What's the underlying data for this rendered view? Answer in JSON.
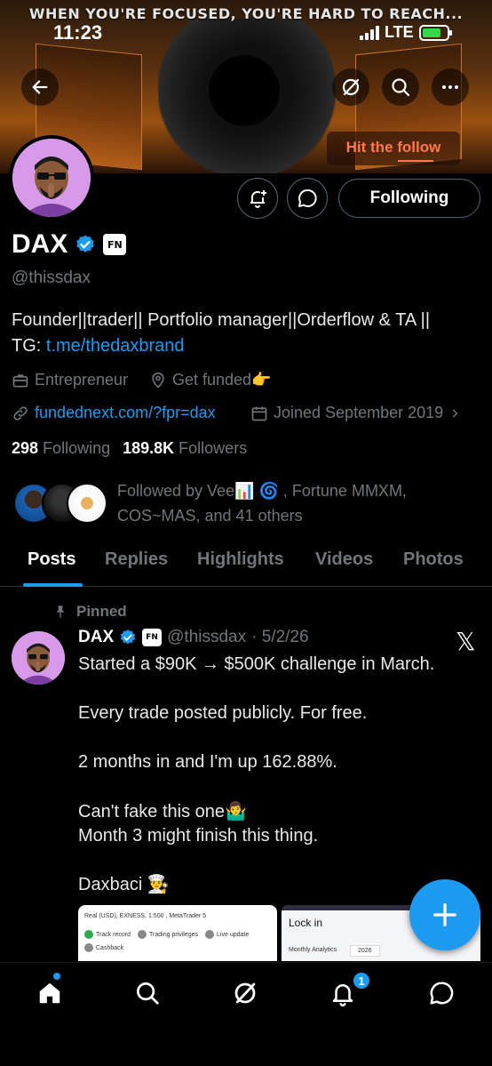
{
  "status_bar": {
    "time": "11:23",
    "network": "LTE"
  },
  "banner": {
    "headline": "WHEN YOU'RE FOCUSED, YOU'RE HARD TO REACH...",
    "cta": "Hit the follow"
  },
  "header_icons": [
    "back-arrow-icon",
    "grok-icon",
    "search-icon",
    "more-icon"
  ],
  "profile": {
    "name": "DAX",
    "handle": "@thissdax",
    "badge": "FN",
    "bio_text": "Founder||trader|| Portfolio manager||Orderflow & TA ||",
    "bio_tg_label": "TG: ",
    "bio_tg_link": "t.me/thedaxbrand",
    "category": "Entrepreneur",
    "location": "Get funded👉",
    "website": "fundednext.com/?fpr=dax",
    "joined": "Joined September 2019",
    "following_count": "298",
    "following_label": "Following",
    "followers_count": "189.8K",
    "followers_label": "Followers",
    "followed_by": "Followed by Vee📊 🌀 , Fortune MMXM, COS~MAS, and 41 others",
    "follow_button": "Following"
  },
  "tabs": [
    "Posts",
    "Replies",
    "Highlights",
    "Videos",
    "Photos"
  ],
  "active_tab": "Posts",
  "pinned_post": {
    "pinned_label": "Pinned",
    "author": "DAX",
    "badge": "FN",
    "handle": "@thissdax",
    "date": "· 5/2/26",
    "text": "Started a $90K → $500K challenge in March.\n\nEvery trade posted publicly. For free.\n\n2 months in and I'm up 162.88%.\n\nCan't fake this one🤷‍♂️\nMonth 3 might finish this thing.\n\nDaxbaci 👨‍🍳",
    "media": [
      {
        "account_line": "Real (USD), EXNESS, 1:500 , MetaTrader 5",
        "items": [
          "Track record",
          "Trading privileges",
          "Live update"
        ],
        "items2": [
          "Cashback"
        ]
      },
      {
        "title": "Lock in",
        "label": "Monthly Analytics",
        "year": "2026"
      }
    ]
  },
  "bottom_nav": {
    "items": [
      "home-icon",
      "search-icon",
      "grok-icon",
      "notifications-icon",
      "messages-icon"
    ],
    "notification_count": "1"
  },
  "colors": {
    "accent": "#1d9bf0",
    "background": "#000000",
    "secondary_text": "#71767b",
    "banner_orange": "#ff7a4a"
  }
}
